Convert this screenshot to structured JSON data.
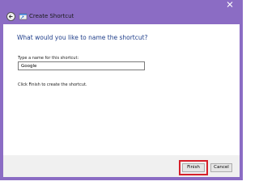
{
  "window": {
    "title": "Create Shortcut",
    "close_icon": "close-icon",
    "back_icon": "back-arrow-icon",
    "app_icon": "shortcut-icon"
  },
  "page": {
    "heading": "What would you like to name the shortcut?",
    "field_label": "Type a name for this shortcut:",
    "name_value": "Google",
    "instruction": "Click Finish to create the shortcut."
  },
  "buttons": {
    "finish_label": "Finish",
    "cancel_label": "Cancel"
  },
  "colors": {
    "frame": "#8b6cc4",
    "heading": "#1f3e8a",
    "highlight": "#d6202b"
  }
}
